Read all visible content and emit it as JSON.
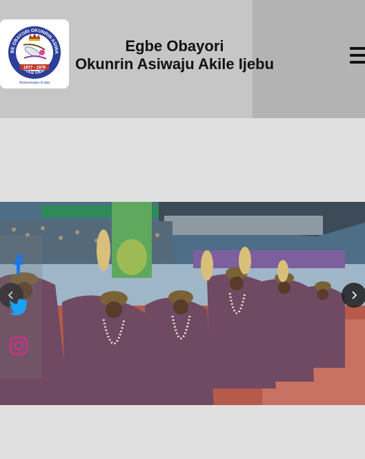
{
  "header": {
    "title_line1": "Egbe Obayori",
    "title_line2": "Okunrin Asiwaju Akile Ijebu",
    "logo": {
      "ring_text": "EGBE OBAYORI OKUNRIN ASIWAJU",
      "bottom_text": "AKILE IJEBU",
      "years": "1977 - 1979",
      "motto": "Ifowosowopo lo daa",
      "ring_color": "#2d3f9a"
    },
    "menu_icon": "hamburger-icon"
  },
  "hero": {
    "image_alt": "Members in traditional attire at stadium celebration",
    "prev_icon": "chevron-left-icon",
    "next_icon": "chevron-right-icon"
  },
  "social": {
    "items": [
      {
        "name": "facebook",
        "icon": "facebook-icon",
        "color": "#1877f2"
      },
      {
        "name": "twitter",
        "icon": "twitter-icon",
        "color": "#1da1f2"
      },
      {
        "name": "instagram",
        "icon": "instagram-icon",
        "color": "#c13584"
      }
    ]
  }
}
